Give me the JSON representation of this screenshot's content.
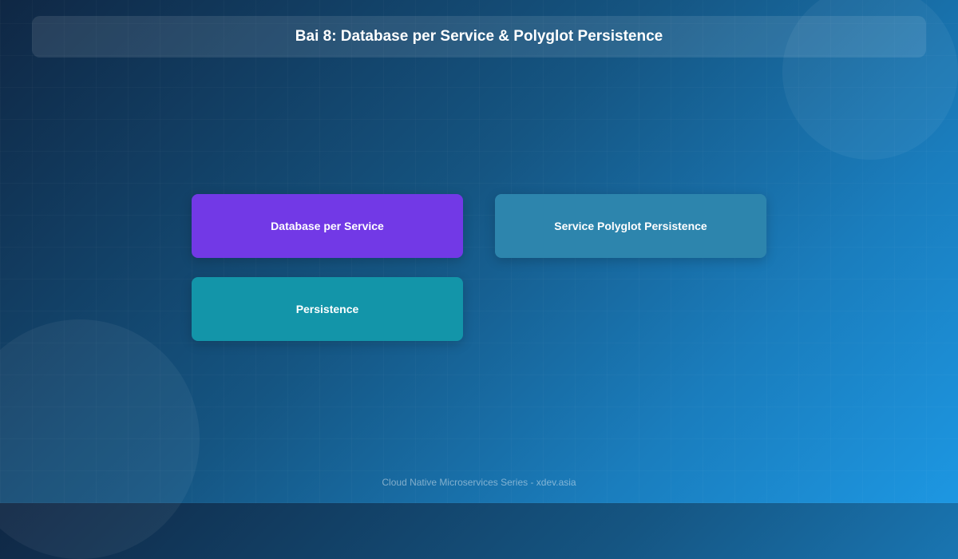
{
  "header": {
    "title": "Bai 8: Database per Service & Polyglot Persistence"
  },
  "cards": [
    {
      "label": "Database per Service",
      "color": "#7239e6"
    },
    {
      "label": "Service Polyglot Persistence",
      "color": "#2d85ad"
    },
    {
      "label": "Persistence",
      "color": "#1395a9"
    }
  ],
  "footer": {
    "text": "Cloud Native Microservices Series - xdev.asia"
  },
  "colors": {
    "background_start": "#0f2744",
    "background_end": "#1d97e2"
  }
}
